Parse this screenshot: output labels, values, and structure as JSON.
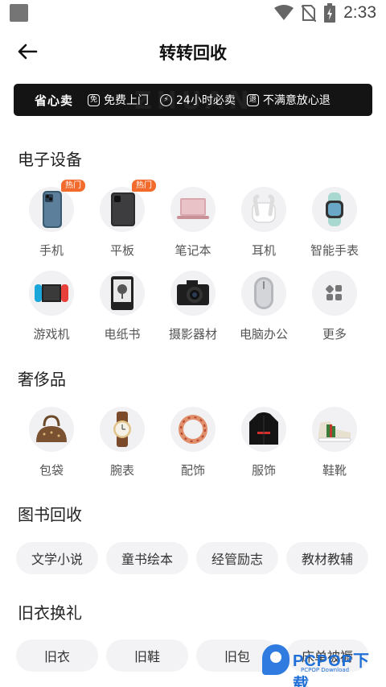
{
  "status_bar": {
    "time": "2:33"
  },
  "header": {
    "title": "转转回收"
  },
  "banner": {
    "title": "省心卖",
    "features": [
      {
        "icon": "免",
        "label": "免费上门"
      },
      {
        "icon": "⚡",
        "label": "24小时必卖"
      },
      {
        "icon": "退",
        "label": "不满意放心退"
      }
    ]
  },
  "sections": {
    "electronics": {
      "title": "电子设备",
      "items": [
        {
          "label": "手机",
          "badge": "热门",
          "icon": "phone-icon"
        },
        {
          "label": "平板",
          "badge": "热门",
          "icon": "tablet-icon"
        },
        {
          "label": "笔记本",
          "icon": "laptop-icon"
        },
        {
          "label": "耳机",
          "icon": "earbuds-icon"
        },
        {
          "label": "智能手表",
          "icon": "smartwatch-icon"
        },
        {
          "label": "游戏机",
          "icon": "game-console-icon"
        },
        {
          "label": "电纸书",
          "icon": "ereader-icon"
        },
        {
          "label": "摄影器材",
          "icon": "camera-icon"
        },
        {
          "label": "电脑办公",
          "icon": "mouse-icon"
        },
        {
          "label": "更多",
          "icon": "more-grid-icon"
        }
      ]
    },
    "luxury": {
      "title": "奢侈品",
      "items": [
        {
          "label": "包袋",
          "icon": "handbag-icon"
        },
        {
          "label": "腕表",
          "icon": "wristwatch-icon"
        },
        {
          "label": "配饰",
          "icon": "bracelet-icon"
        },
        {
          "label": "服饰",
          "icon": "jacket-icon"
        },
        {
          "label": "鞋靴",
          "icon": "sneaker-icon"
        }
      ]
    },
    "books": {
      "title": "图书回收",
      "chips": [
        "文学小说",
        "童书绘本",
        "经管励志",
        "教材教辅"
      ]
    },
    "clothes": {
      "title": "旧衣换礼",
      "chips": [
        "旧衣",
        "旧鞋",
        "旧包",
        "床单被褥"
      ]
    }
  },
  "watermark": {
    "brand": "PCPOP下载",
    "sub": "PCPOP Download"
  },
  "colors": {
    "banner_bg": "#141414",
    "hot_badge": "#f26a2c",
    "chip_bg": "#f3f3f5",
    "icon_circle_bg": "#f1f1f3"
  }
}
